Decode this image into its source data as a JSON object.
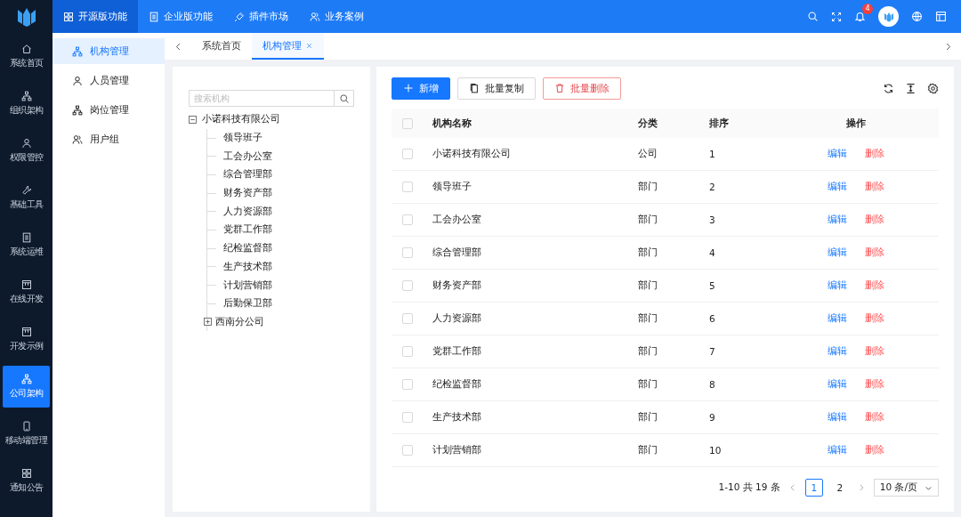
{
  "rail": {
    "items": [
      {
        "label": "系统首页",
        "selected": false
      },
      {
        "label": "组织架构",
        "selected": false
      },
      {
        "label": "权限管控",
        "selected": false
      },
      {
        "label": "基础工具",
        "selected": false
      },
      {
        "label": "系统运维",
        "selected": false
      },
      {
        "label": "在线开发",
        "selected": false
      },
      {
        "label": "开发示例",
        "selected": false
      },
      {
        "label": "公司架构",
        "selected": true
      },
      {
        "label": "移动端管理",
        "selected": false
      },
      {
        "label": "通知公告",
        "selected": false
      }
    ]
  },
  "topnav": [
    {
      "label": "开源版功能",
      "selected": true
    },
    {
      "label": "企业版功能",
      "selected": false
    },
    {
      "label": "插件市场",
      "selected": false
    },
    {
      "label": "业务案例",
      "selected": false
    }
  ],
  "notifications": {
    "badge": "4"
  },
  "submenu": [
    {
      "label": "机构管理",
      "selected": true
    },
    {
      "label": "人员管理",
      "selected": false
    },
    {
      "label": "岗位管理",
      "selected": false
    },
    {
      "label": "用户组",
      "selected": false
    }
  ],
  "tabs": [
    {
      "label": "系统首页",
      "selected": false,
      "closable": false
    },
    {
      "label": "机构管理",
      "selected": true,
      "closable": true
    }
  ],
  "tree": {
    "search": {
      "placeholder": "搜索机构"
    },
    "nodes": [
      {
        "label": "小诺科技有限公司",
        "expanded": true,
        "children": [
          {
            "label": "领导班子"
          },
          {
            "label": "工会办公室"
          },
          {
            "label": "综合管理部"
          },
          {
            "label": "财务资产部"
          },
          {
            "label": "人力资源部"
          },
          {
            "label": "党群工作部"
          },
          {
            "label": "纪检监督部"
          },
          {
            "label": "生产技术部"
          },
          {
            "label": "计划营销部"
          },
          {
            "label": "后勤保卫部"
          },
          {
            "label": "西南分公司",
            "expanded": false
          }
        ]
      }
    ]
  },
  "toolbar": {
    "buttons": [
      {
        "label": "新增",
        "kind": "primary"
      },
      {
        "label": "批量复制",
        "kind": "default"
      },
      {
        "label": "批量删除",
        "kind": "danger"
      }
    ]
  },
  "table": {
    "select_all_checked": false,
    "columns": [
      "机构名称",
      "分类",
      "排序",
      "操作"
    ],
    "rows": [
      {
        "name": "小诺科技有限公司",
        "category": "公司",
        "sort": "1",
        "checked": false,
        "actions": [
          "编辑",
          "删除"
        ]
      },
      {
        "name": "领导班子",
        "category": "部门",
        "sort": "2",
        "checked": false,
        "actions": [
          "编辑",
          "删除"
        ]
      },
      {
        "name": "工会办公室",
        "category": "部门",
        "sort": "3",
        "checked": false,
        "actions": [
          "编辑",
          "删除"
        ]
      },
      {
        "name": "综合管理部",
        "category": "部门",
        "sort": "4",
        "checked": false,
        "actions": [
          "编辑",
          "删除"
        ]
      },
      {
        "name": "财务资产部",
        "category": "部门",
        "sort": "5",
        "checked": false,
        "actions": [
          "编辑",
          "删除"
        ]
      },
      {
        "name": "人力资源部",
        "category": "部门",
        "sort": "6",
        "checked": false,
        "actions": [
          "编辑",
          "删除"
        ]
      },
      {
        "name": "党群工作部",
        "category": "部门",
        "sort": "7",
        "checked": false,
        "actions": [
          "编辑",
          "删除"
        ]
      },
      {
        "name": "纪检监督部",
        "category": "部门",
        "sort": "8",
        "checked": false,
        "actions": [
          "编辑",
          "删除"
        ]
      },
      {
        "name": "生产技术部",
        "category": "部门",
        "sort": "9",
        "checked": false,
        "actions": [
          "编辑",
          "删除"
        ]
      },
      {
        "name": "计划营销部",
        "category": "部门",
        "sort": "10",
        "checked": false,
        "actions": [
          "编辑",
          "删除"
        ]
      }
    ]
  },
  "pagination": {
    "total": "1-10 共 19 条",
    "pages": [
      {
        "label": "1",
        "selected": true
      },
      {
        "label": "2",
        "selected": false
      }
    ],
    "page_size": "10 条/页"
  }
}
